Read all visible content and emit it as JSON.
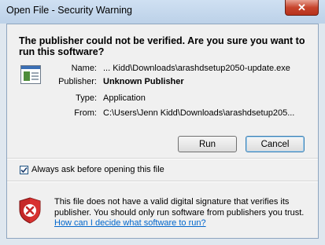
{
  "window": {
    "title": "Open File - Security Warning",
    "close_label": "✕"
  },
  "dialog": {
    "heading": "The publisher could not be verified.  Are you sure you want to run this software?",
    "fields": [
      {
        "label": "Name:",
        "value": "... Kidd\\Downloads\\arashdsetup2050-update.exe",
        "bold": false
      },
      {
        "label": "Publisher:",
        "value": "Unknown Publisher",
        "bold": true
      },
      {
        "label": "Type:",
        "value": "Application",
        "bold": false
      },
      {
        "label": "From:",
        "value": "C:\\Users\\Jenn Kidd\\Downloads\\arashdsetup205...",
        "bold": false
      }
    ],
    "run_label": "Run",
    "cancel_label": "Cancel",
    "always_ask": {
      "label": "Always ask before opening this file",
      "checked": true
    },
    "warning_text": "This file does not have a valid digital signature that verifies its publisher.  You should only run software from publishers you trust.",
    "help_link": "How can I decide what software to run?"
  }
}
